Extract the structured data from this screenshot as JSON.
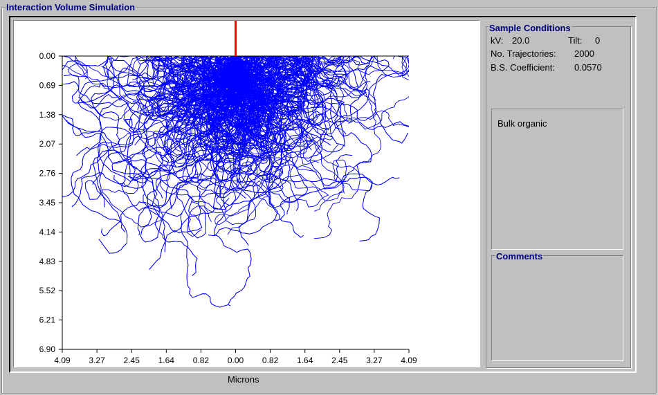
{
  "window": {
    "title": "Interaction Volume Simulation"
  },
  "plot": {
    "xlabel": "Microns"
  },
  "sample_conditions": {
    "title": "Sample Conditions",
    "kv_label": "kV:",
    "kv_value": "20.0",
    "tilt_label": "Tilt:",
    "tilt_value": "0",
    "trajectories_label": "No. Trajectories:",
    "trajectories_value": "2000",
    "bs_label": "B.S. Coefficient:",
    "bs_value": "0.0570"
  },
  "sample": {
    "name": "Bulk organic"
  },
  "comments": {
    "title": "Comments",
    "text": ""
  },
  "chart_data": {
    "type": "scatter",
    "xlabel": "Microns",
    "ylabel": "",
    "x_ticks": [
      "4.09",
      "3.27",
      "2.45",
      "1.64",
      "0.82",
      "0.00",
      "0.82",
      "1.64",
      "2.45",
      "3.27",
      "4.09"
    ],
    "y_ticks": [
      "0.00",
      "0.69",
      "1.38",
      "2.07",
      "2.76",
      "3.45",
      "4.14",
      "4.83",
      "5.52",
      "6.21",
      "6.90"
    ],
    "xlim": [
      -4.09,
      4.09
    ],
    "ylim": [
      0,
      6.9
    ],
    "num_trajectories": 2000,
    "beam_position_x": 0.0,
    "trajectory_color": "#0000ff",
    "beam_color": "#ff0000"
  }
}
